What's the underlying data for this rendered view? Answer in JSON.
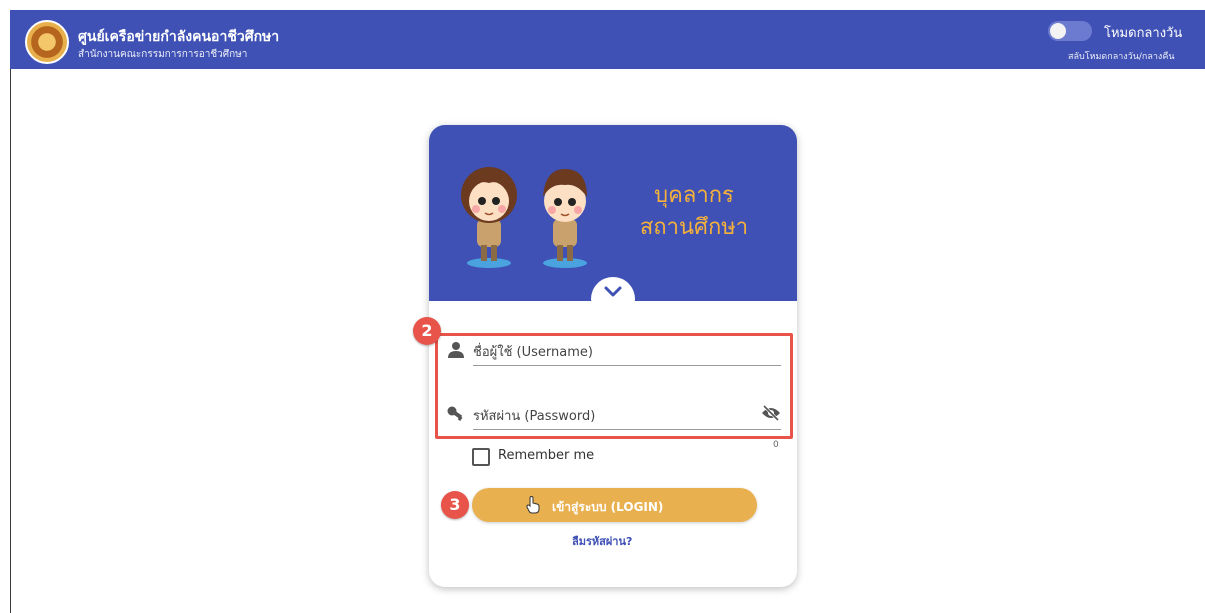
{
  "header": {
    "org_title": "ศูนย์เครือข่ายกำลังคนอาชีวศึกษา",
    "org_subtitle": "สำนักงานคณะกรรมการการอาชีวศึกษา",
    "logo_icon": "org-seal-logo",
    "mode_label": "โหมดกลางวัน",
    "mode_hint": "สลับโหมดกลางวัน/กลางคืน",
    "mode_toggle_on": false
  },
  "card": {
    "title_line1": "บุคลากร",
    "title_line2": "สถานศึกษา",
    "expand_icon": "chevron-down-icon"
  },
  "form": {
    "username_placeholder": "ชื่อผู้ใช้ (Username)",
    "username_value": "",
    "password_placeholder": "รหัสผ่าน (Password)",
    "password_value": "",
    "password_counter": "0",
    "remember_label": "Remember me",
    "remember_checked": false,
    "login_label": "เข้าสู่ระบบ (LOGIN)",
    "forgot_label": "ลืมรหัสผ่าน?"
  },
  "annotations": {
    "step_fields": "2",
    "step_login": "3"
  },
  "colors": {
    "primary": "#3f51b5",
    "accent": "#e9b04f",
    "title_gold": "#f6b13b",
    "callout_red": "#e8534a"
  }
}
